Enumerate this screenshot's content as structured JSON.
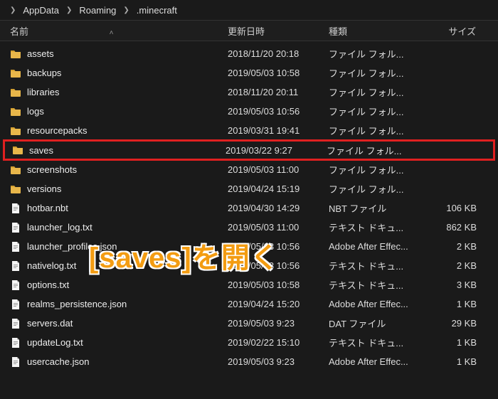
{
  "breadcrumb": {
    "items": [
      "AppData",
      "Roaming",
      ".minecraft"
    ]
  },
  "columns": {
    "name": "名前",
    "date": "更新日時",
    "type": "種類",
    "size": "サイズ"
  },
  "files": [
    {
      "icon": "folder",
      "name": "assets",
      "date": "2018/11/20 20:18",
      "type": "ファイル フォル...",
      "size": ""
    },
    {
      "icon": "folder",
      "name": "backups",
      "date": "2019/05/03 10:58",
      "type": "ファイル フォル...",
      "size": ""
    },
    {
      "icon": "folder",
      "name": "libraries",
      "date": "2018/11/20 20:11",
      "type": "ファイル フォル...",
      "size": ""
    },
    {
      "icon": "folder",
      "name": "logs",
      "date": "2019/05/03 10:56",
      "type": "ファイル フォル...",
      "size": ""
    },
    {
      "icon": "folder",
      "name": "resourcepacks",
      "date": "2019/03/31 19:41",
      "type": "ファイル フォル...",
      "size": ""
    },
    {
      "icon": "folder",
      "name": "saves",
      "date": "2019/03/22 9:27",
      "type": "ファイル フォル...",
      "size": "",
      "highlight": true
    },
    {
      "icon": "folder",
      "name": "screenshots",
      "date": "2019/05/03 11:00",
      "type": "ファイル フォル...",
      "size": ""
    },
    {
      "icon": "folder",
      "name": "versions",
      "date": "2019/04/24 15:19",
      "type": "ファイル フォル...",
      "size": ""
    },
    {
      "icon": "file",
      "name": "hotbar.nbt",
      "date": "2019/04/30 14:29",
      "type": "NBT ファイル",
      "size": "106 KB"
    },
    {
      "icon": "file",
      "name": "launcher_log.txt",
      "date": "2019/05/03 11:00",
      "type": "テキスト ドキュ...",
      "size": "862 KB"
    },
    {
      "icon": "file",
      "name": "launcher_profiles.json",
      "date": "2019/05/03 10:56",
      "type": "Adobe After Effec...",
      "size": "2 KB"
    },
    {
      "icon": "file",
      "name": "nativelog.txt",
      "date": "2019/05/03 10:56",
      "type": "テキスト ドキュ...",
      "size": "2 KB"
    },
    {
      "icon": "file",
      "name": "options.txt",
      "date": "2019/05/03 10:58",
      "type": "テキスト ドキュ...",
      "size": "3 KB"
    },
    {
      "icon": "file",
      "name": "realms_persistence.json",
      "date": "2019/04/24 15:20",
      "type": "Adobe After Effec...",
      "size": "1 KB"
    },
    {
      "icon": "file",
      "name": "servers.dat",
      "date": "2019/05/03 9:23",
      "type": "DAT ファイル",
      "size": "29 KB"
    },
    {
      "icon": "file",
      "name": "updateLog.txt",
      "date": "2019/02/22 15:10",
      "type": "テキスト ドキュ...",
      "size": "1 KB"
    },
    {
      "icon": "file",
      "name": "usercache.json",
      "date": "2019/05/03 9:23",
      "type": "Adobe After Effec...",
      "size": "1 KB"
    }
  ],
  "overlay": "[saves]を開く"
}
